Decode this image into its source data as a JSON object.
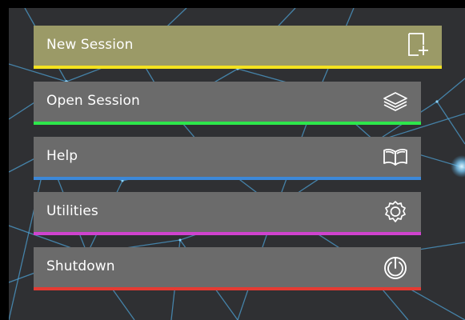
{
  "menu": {
    "items": [
      {
        "label": "New Session",
        "accent": "#f4e21f",
        "icon": "new-session-icon",
        "state": "selected"
      },
      {
        "label": "Open Session",
        "accent": "#2ee64b",
        "icon": "layers-icon"
      },
      {
        "label": "Help",
        "accent": "#3c88d8",
        "icon": "book-icon"
      },
      {
        "label": "Utilities",
        "accent": "#d043cf",
        "icon": "gear-icon"
      },
      {
        "label": "Shutdown",
        "accent": "#e53a32",
        "icon": "power-icon"
      }
    ]
  },
  "theme": {
    "panel_background": "#2f3033",
    "item_background": "#6b6b6b",
    "selected_background": "#9b9a67",
    "network_line_color": "#4ea2d6"
  }
}
